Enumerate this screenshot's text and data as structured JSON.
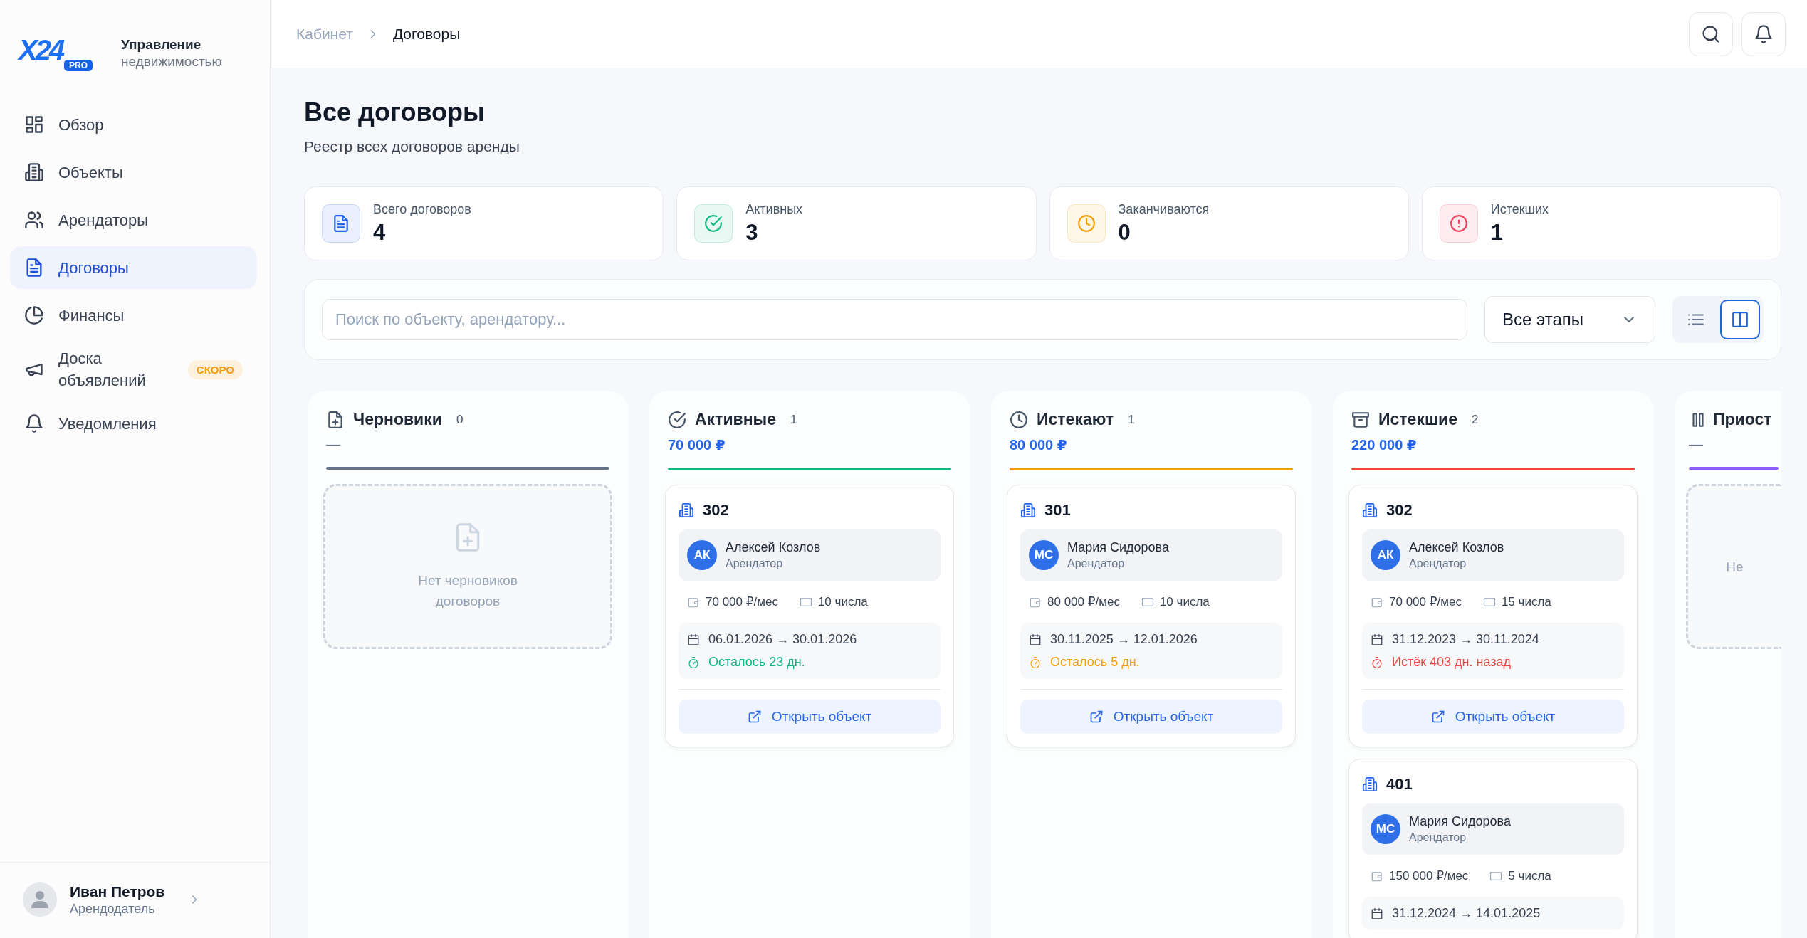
{
  "brand": {
    "logo": "X24",
    "badge": "PRO",
    "title": "Управление",
    "subtitle": "недвижимостью"
  },
  "nav": [
    {
      "label": "Обзор",
      "selected": false
    },
    {
      "label": "Объекты",
      "selected": false
    },
    {
      "label": "Арендаторы",
      "selected": false
    },
    {
      "label": "Договоры",
      "selected": true
    },
    {
      "label": "Финансы",
      "selected": false
    },
    {
      "label": "Доска объявлений",
      "selected": false,
      "badge": "СКОРО"
    },
    {
      "label": "Уведомления",
      "selected": false
    }
  ],
  "user": {
    "name": "Иван Петров",
    "role": "Арендодатель"
  },
  "breadcrumb": [
    "Кабинет",
    "Договоры"
  ],
  "page": {
    "title": "Все договоры",
    "subtitle": "Реестр всех договоров аренды"
  },
  "stats": [
    {
      "label": "Всего договоров",
      "value": "4",
      "color": "#2563eb"
    },
    {
      "label": "Активных",
      "value": "3",
      "color": "#10b981"
    },
    {
      "label": "Заканчиваются",
      "value": "0",
      "color": "#f59e0b"
    },
    {
      "label": "Истекших",
      "value": "1",
      "color": "#f43f5e"
    }
  ],
  "filters": {
    "placeholder": "Поиск по объекту, арендатору...",
    "stage": "Все этапы",
    "views": [
      {
        "selected": false
      },
      {
        "selected": true
      }
    ]
  },
  "columns": [
    {
      "title": "Черновики",
      "count": "0",
      "amount": "—",
      "color": "#64748b",
      "empty_text": "Нет черновиков договоров"
    },
    {
      "title": "Активные",
      "count": "1",
      "amount": "70 000 ₽",
      "color": "#10b981",
      "cards": [
        {
          "unit": "302",
          "initials": "АК",
          "tenant": "Алексей Козлов",
          "role": "Арендатор",
          "rent": "70 000 ₽/мес",
          "pay_day": "10 числа",
          "period": "06.01.2026 → 30.01.2026",
          "status": {
            "text": "Осталось 23 дн.",
            "kind": "ok"
          },
          "action": "Открыть объект"
        }
      ]
    },
    {
      "title": "Истекают",
      "count": "1",
      "amount": "80 000 ₽",
      "color": "#f59e0b",
      "cards": [
        {
          "unit": "301",
          "initials": "МС",
          "tenant": "Мария Сидорова",
          "role": "Арендатор",
          "rent": "80 000 ₽/мес",
          "pay_day": "10 числа",
          "period": "30.11.2025 → 12.01.2026",
          "status": {
            "text": "Осталось 5 дн.",
            "kind": "warn"
          },
          "action": "Открыть объект"
        }
      ]
    },
    {
      "title": "Истекшие",
      "count": "2",
      "amount": "220 000 ₽",
      "color": "#ef4444",
      "cards": [
        {
          "unit": "302",
          "initials": "АК",
          "tenant": "Алексей Козлов",
          "role": "Арендатор",
          "rent": "70 000 ₽/мес",
          "pay_day": "15 числа",
          "period": "31.12.2023 → 30.11.2024",
          "status": {
            "text": "Истёк 403 дн. назад",
            "kind": "expired"
          },
          "action": "Открыть объект"
        },
        {
          "unit": "401",
          "initials": "МС",
          "tenant": "Мария Сидорова",
          "role": "Арендатор",
          "rent": "150 000 ₽/мес",
          "pay_day": "5 числа",
          "period": "31.12.2024 → 14.01.2025"
        }
      ]
    },
    {
      "title": "Приост",
      "amount": "—",
      "color": "#8b5cf6",
      "empty_text": "Не"
    }
  ]
}
